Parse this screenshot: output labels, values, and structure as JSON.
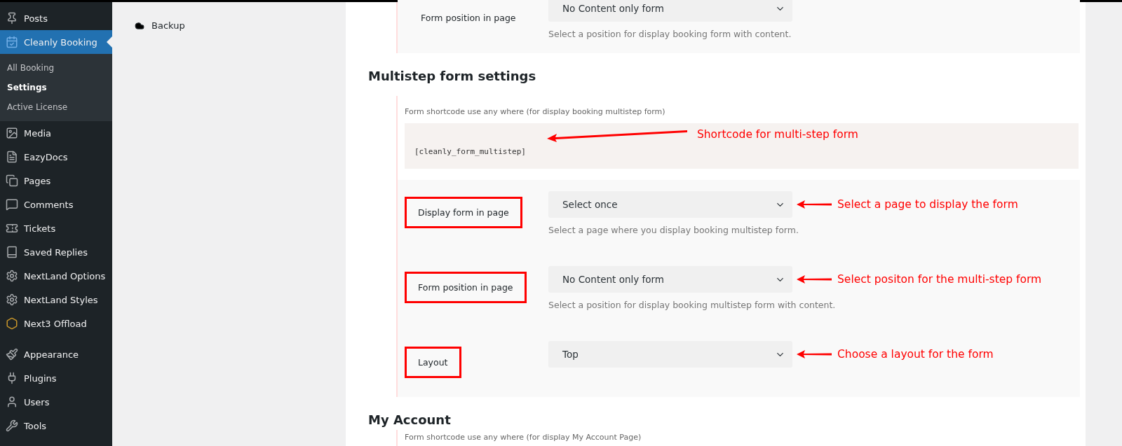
{
  "sidebar": {
    "items": [
      {
        "label": "Posts",
        "selected": false
      },
      {
        "label": "Cleanly Booking",
        "selected": true,
        "children": [
          {
            "label": "All Booking",
            "selected": false
          },
          {
            "label": "Settings",
            "selected": true
          },
          {
            "label": "Active License",
            "selected": false
          }
        ]
      },
      {
        "label": "Media",
        "selected": false
      },
      {
        "label": "EazyDocs",
        "selected": false
      },
      {
        "label": "Pages",
        "selected": false
      },
      {
        "label": "Comments",
        "selected": false
      },
      {
        "label": "Tickets",
        "selected": false
      },
      {
        "label": "Saved Replies",
        "selected": false
      },
      {
        "label": "NextLand Options",
        "selected": false
      },
      {
        "label": "NextLand Styles",
        "selected": false
      },
      {
        "label": "Next3 Offload",
        "selected": false
      },
      {
        "label": "Appearance",
        "selected": false
      },
      {
        "label": "Plugins",
        "selected": false
      },
      {
        "label": "Users",
        "selected": false
      },
      {
        "label": "Tools",
        "selected": false
      }
    ]
  },
  "subnav": [
    {
      "label": "Backup"
    }
  ],
  "top_row": {
    "label": "Form position in page",
    "highlighted": false,
    "value": "No Content only form",
    "help": "Select a position for display booking form with content."
  },
  "multistep": {
    "heading": "Multistep form settings",
    "shortcode_label": "Form shortcode use any where (for display booking multistep form)",
    "shortcode": "[cleanly_form_multistep]",
    "shortcode_annotation": "Shortcode for multi-step form",
    "rows": [
      {
        "label": "Display form in page",
        "highlighted": true,
        "value": "Select once",
        "help": "Select a page where you display booking multistep form.",
        "annotation": "Select a page to display the form"
      },
      {
        "label": "Form position in page",
        "highlighted": true,
        "value": "No Content only form",
        "help": "Select a position for display booking multistep form with content.",
        "annotation": "Select positon for the multi-step form"
      },
      {
        "label": "Layout",
        "highlighted": true,
        "value": "Top",
        "annotation": "Choose a layout for the form"
      }
    ]
  },
  "my_account": {
    "heading": "My Account",
    "shortcode_label": "Form shortcode use any where (for display My Account Page)"
  }
}
